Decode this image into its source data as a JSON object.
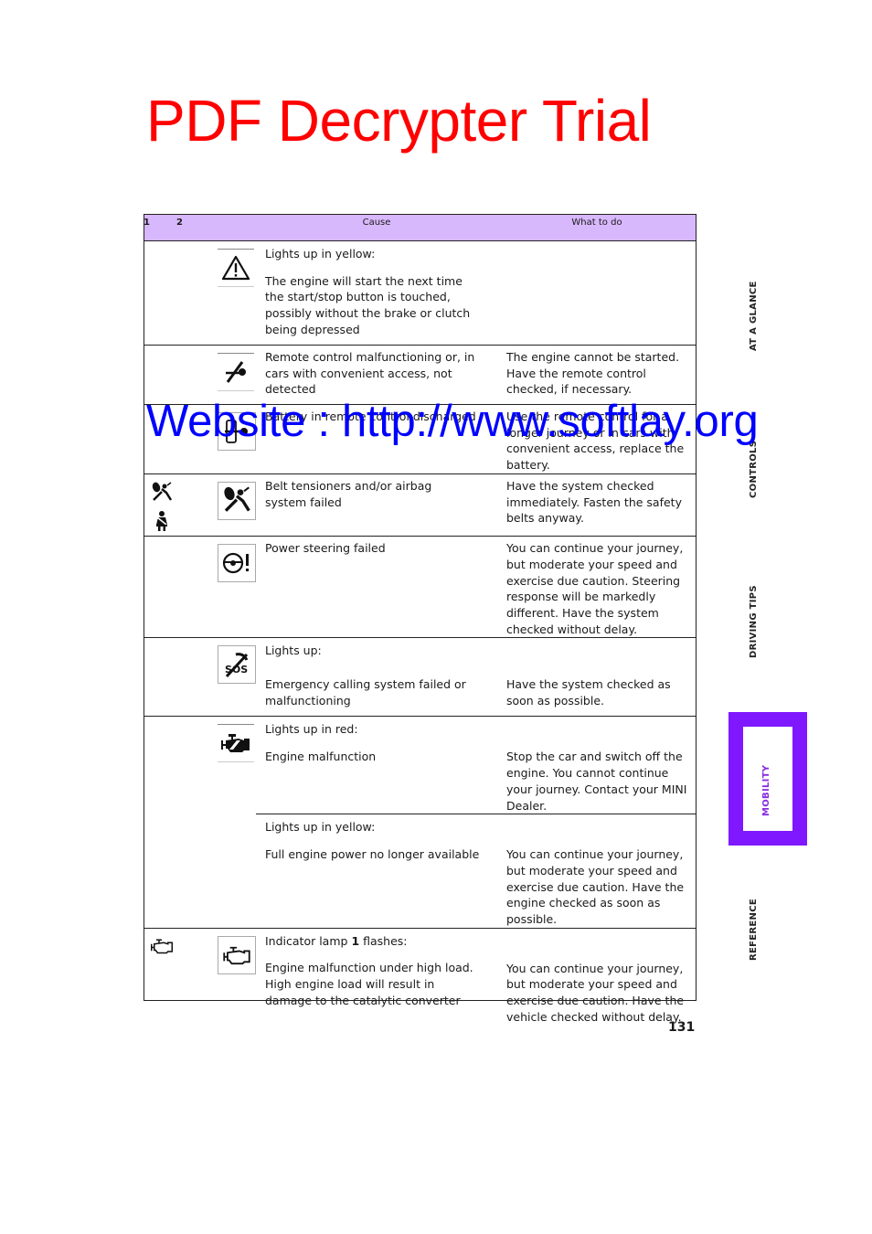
{
  "watermarks": {
    "trial": "PDF Decrypter Trial",
    "website": "Website : http://www.softlay.org"
  },
  "table": {
    "headers": {
      "col1": "1",
      "col2": "2",
      "cause": "Cause",
      "what_to_do": "What to do"
    },
    "rows": [
      {
        "indicator1": "",
        "indicator2": "warning-triangle",
        "cause_intro": "Lights up in yellow:",
        "cause": "The engine will start the next time the start/stop button is touched, possibly without the brake or clutch being depressed",
        "what_to_do": ""
      },
      {
        "indicator1": "",
        "indicator2": "remote-key-crossed",
        "cause": "Remote control malfunctioning or, in cars with convenient access, not detected",
        "what_to_do": "The engine cannot be started. Have the remote control checked, if necessary."
      },
      {
        "indicator1": "",
        "indicator2": "remote-battery",
        "cause": "Battery in remote control discharged",
        "what_to_do": "Use the remote control for a longer journey or in cars with convenient access, replace the battery."
      },
      {
        "indicator1": "airbag-and-seatbelt",
        "indicator2": "airbag",
        "cause": "Belt tensioners and/or airbag system failed",
        "what_to_do": "Have the system checked immediately. Fasten the safety belts anyway."
      },
      {
        "indicator1": "",
        "indicator2": "steering-wheel-exclamation",
        "cause": "Power steering failed",
        "what_to_do": "You can continue your journey, but moderate your speed and exercise due caution. Steering response will be markedly different. Have the system checked without delay."
      },
      {
        "indicator1": "",
        "indicator2": "sos-crossed",
        "cause_intro": "Lights up:",
        "cause": "Emergency calling system failed or malfunctioning",
        "what_to_do": "Have the system checked as soon as possible."
      },
      {
        "indicator1": "",
        "indicator2": "engine-filled",
        "sub": [
          {
            "cause_intro": "Lights up in red:",
            "cause": "Engine malfunction",
            "what_to_do": "Stop the car and switch off the engine. You cannot continue your journey. Contact your MINI Dealer."
          },
          {
            "cause_intro": "Lights up in yellow:",
            "cause": "Full engine power no longer available",
            "what_to_do": "You can continue your journey, but moderate your speed and exercise due caution. Have the engine checked as soon as possible."
          }
        ]
      },
      {
        "indicator1": "engine-outline",
        "indicator2": "engine-outline",
        "cause_intro_pre": "Indicator lamp ",
        "cause_intro_bold": "1",
        "cause_intro_post": " flashes:",
        "cause": "Engine malfunction under high load. High engine load will result in damage to the catalytic converter",
        "what_to_do": "You can continue your journey, but moderate your speed and exercise due caution. Have the vehicle checked without delay."
      }
    ]
  },
  "side_tabs": [
    "AT A GLANCE",
    "CONTROLS",
    "DRIVING TIPS",
    "MOBILITY",
    "REFERENCE"
  ],
  "active_tab": "MOBILITY",
  "colors": {
    "header_bg": "#d8b8fc",
    "active_tab": "#7f17ff",
    "trial_watermark": "#ff0000",
    "website_watermark": "#0000ff"
  },
  "page_number": "131"
}
